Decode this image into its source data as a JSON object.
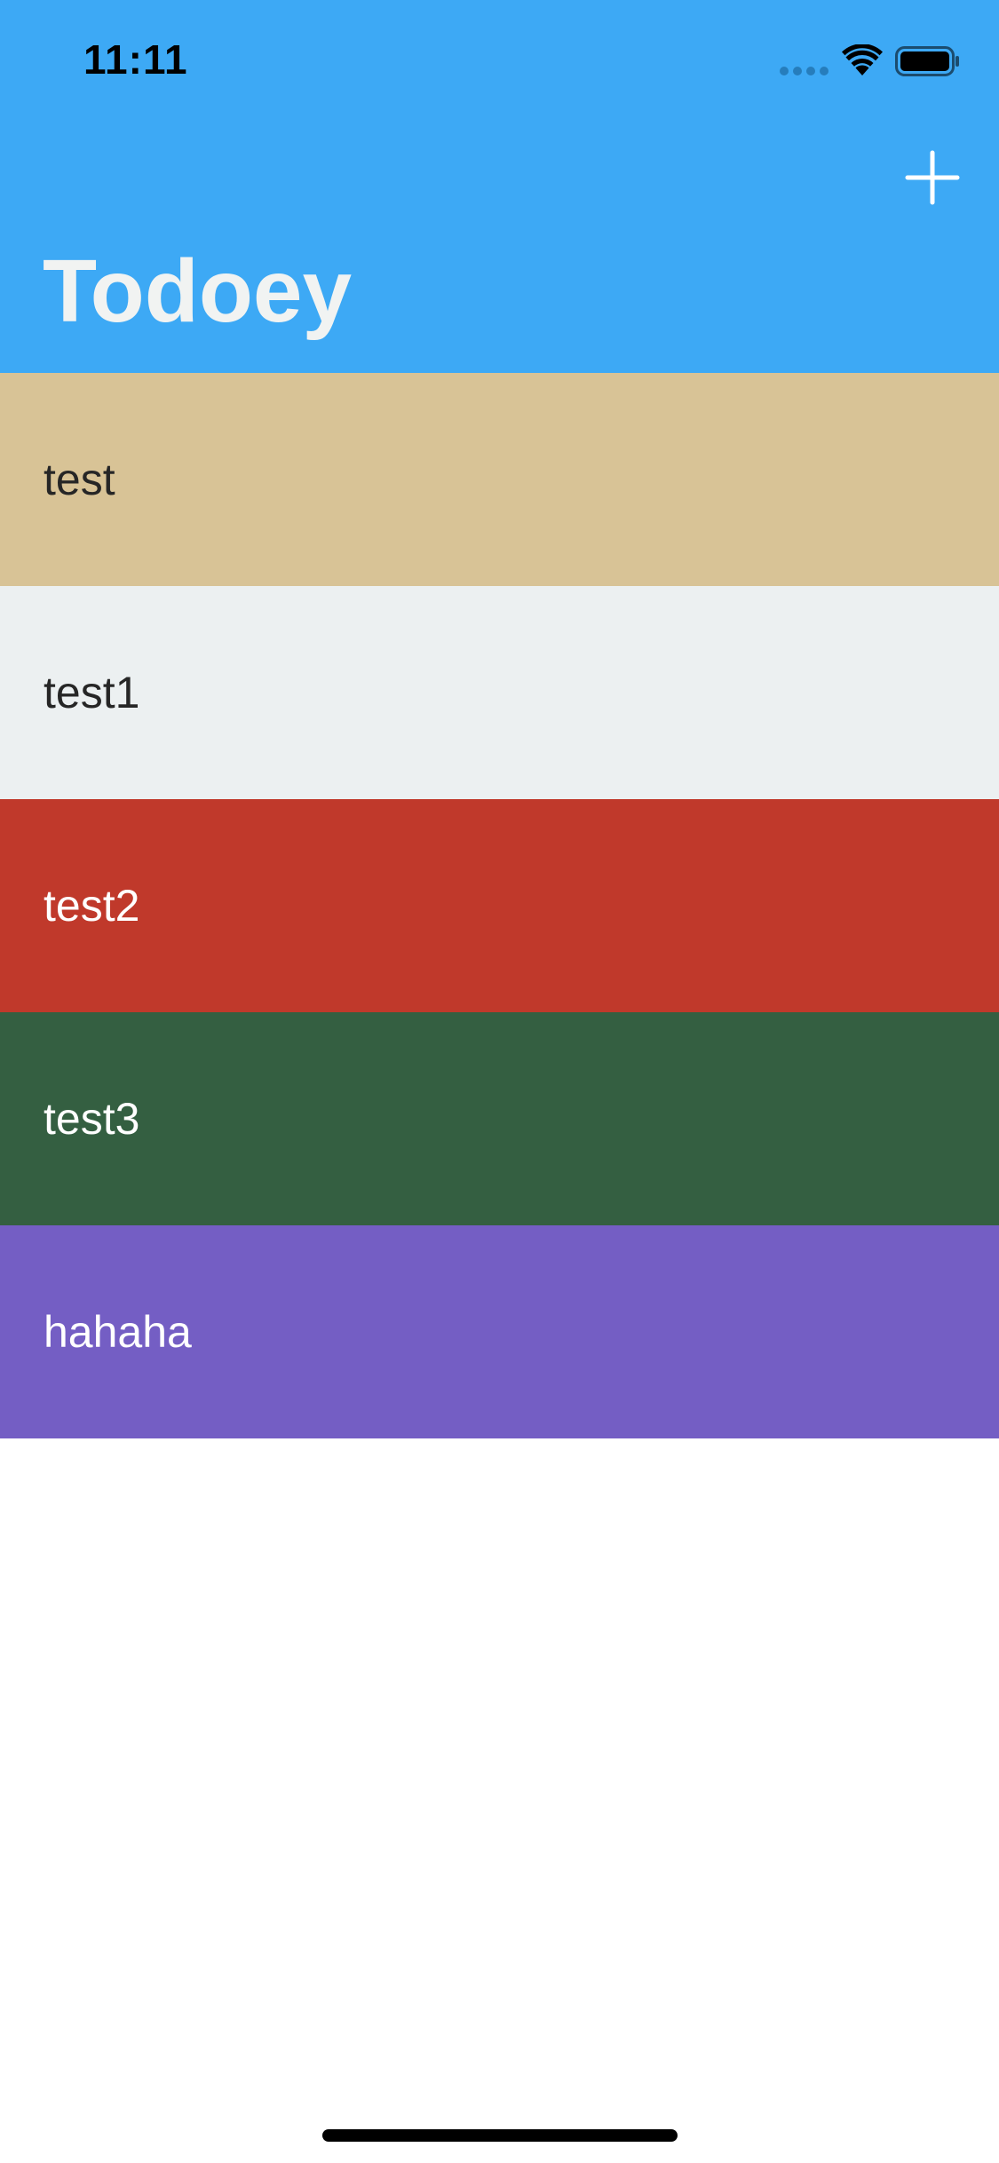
{
  "status_bar": {
    "time": "11:11"
  },
  "nav": {
    "title": "Todoey",
    "add_icon": "plus-icon",
    "background_color": "#3da9f5",
    "title_color": "#f1f3f2"
  },
  "categories": [
    {
      "label": "test",
      "background": "#d8c396",
      "text_color": "#262626"
    },
    {
      "label": "test1",
      "background": "#ecf0f1",
      "text_color": "#262626"
    },
    {
      "label": "test2",
      "background": "#c0392b",
      "text_color": "#ffffff"
    },
    {
      "label": "test3",
      "background": "#345f41",
      "text_color": "#ffffff"
    },
    {
      "label": "hahaha",
      "background": "#745ec4",
      "text_color": "#ffffff"
    }
  ]
}
